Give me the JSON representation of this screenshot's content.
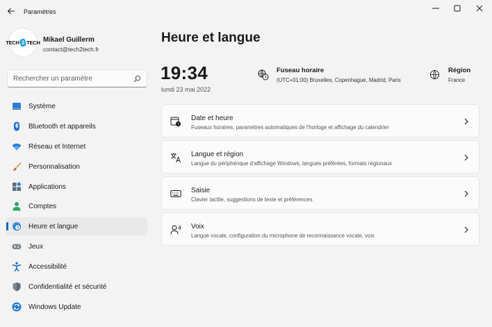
{
  "window": {
    "title": "Paramètres"
  },
  "profile": {
    "avatar_text_left": "TECH",
    "avatar_text_mid": "2",
    "avatar_text_right": "TECH",
    "name": "Mikael Guillerm",
    "email": "contact@tech2tech.fr"
  },
  "search": {
    "placeholder": "Rechercher un paramètre"
  },
  "sidebar": {
    "items": [
      {
        "label": "Système",
        "icon": "system-icon",
        "active": false
      },
      {
        "label": "Bluetooth et appareils",
        "icon": "bluetooth-icon",
        "active": false
      },
      {
        "label": "Réseau et Internet",
        "icon": "wifi-icon",
        "active": false
      },
      {
        "label": "Personnalisation",
        "icon": "brush-icon",
        "active": false
      },
      {
        "label": "Applications",
        "icon": "apps-icon",
        "active": false
      },
      {
        "label": "Comptes",
        "icon": "account-icon",
        "active": false
      },
      {
        "label": "Heure et langue",
        "icon": "globe-clock-icon",
        "active": true
      },
      {
        "label": "Jeux",
        "icon": "gamepad-icon",
        "active": false
      },
      {
        "label": "Accessibilité",
        "icon": "accessibility-icon",
        "active": false
      },
      {
        "label": "Confidentialité et sécurité",
        "icon": "shield-icon",
        "active": false
      },
      {
        "label": "Windows Update",
        "icon": "update-icon",
        "active": false
      }
    ]
  },
  "main": {
    "title": "Heure et langue",
    "time": "19:34",
    "date": "lundi 23 mai 2022",
    "timezone": {
      "title": "Fuseau horaire",
      "value": "(UTC+01:00) Bruxelles, Copenhague, Madrid, Paris"
    },
    "region": {
      "title": "Région",
      "value": "France"
    },
    "cards": [
      {
        "title": "Date et heure",
        "subtitle": "Fuseaux horaires, paramètres automatiques de l'horloge et affichage du calendrier",
        "icon": "calendar-clock-icon"
      },
      {
        "title": "Langue et région",
        "subtitle": "Langue du périphérique d'affichage Windows, langues préférées, formats régionaux",
        "icon": "language-icon"
      },
      {
        "title": "Saisie",
        "subtitle": "Clavier tactile, suggestions de texte et préférences",
        "icon": "keyboard-icon"
      },
      {
        "title": "Voix",
        "subtitle": "Langue vocale, configuration du microphone de reconnaissance vocale, voix",
        "icon": "voice-icon"
      }
    ]
  },
  "colors": {
    "accent": "#0067c0",
    "background": "#f3f3f3",
    "card": "#fbfbfb"
  }
}
